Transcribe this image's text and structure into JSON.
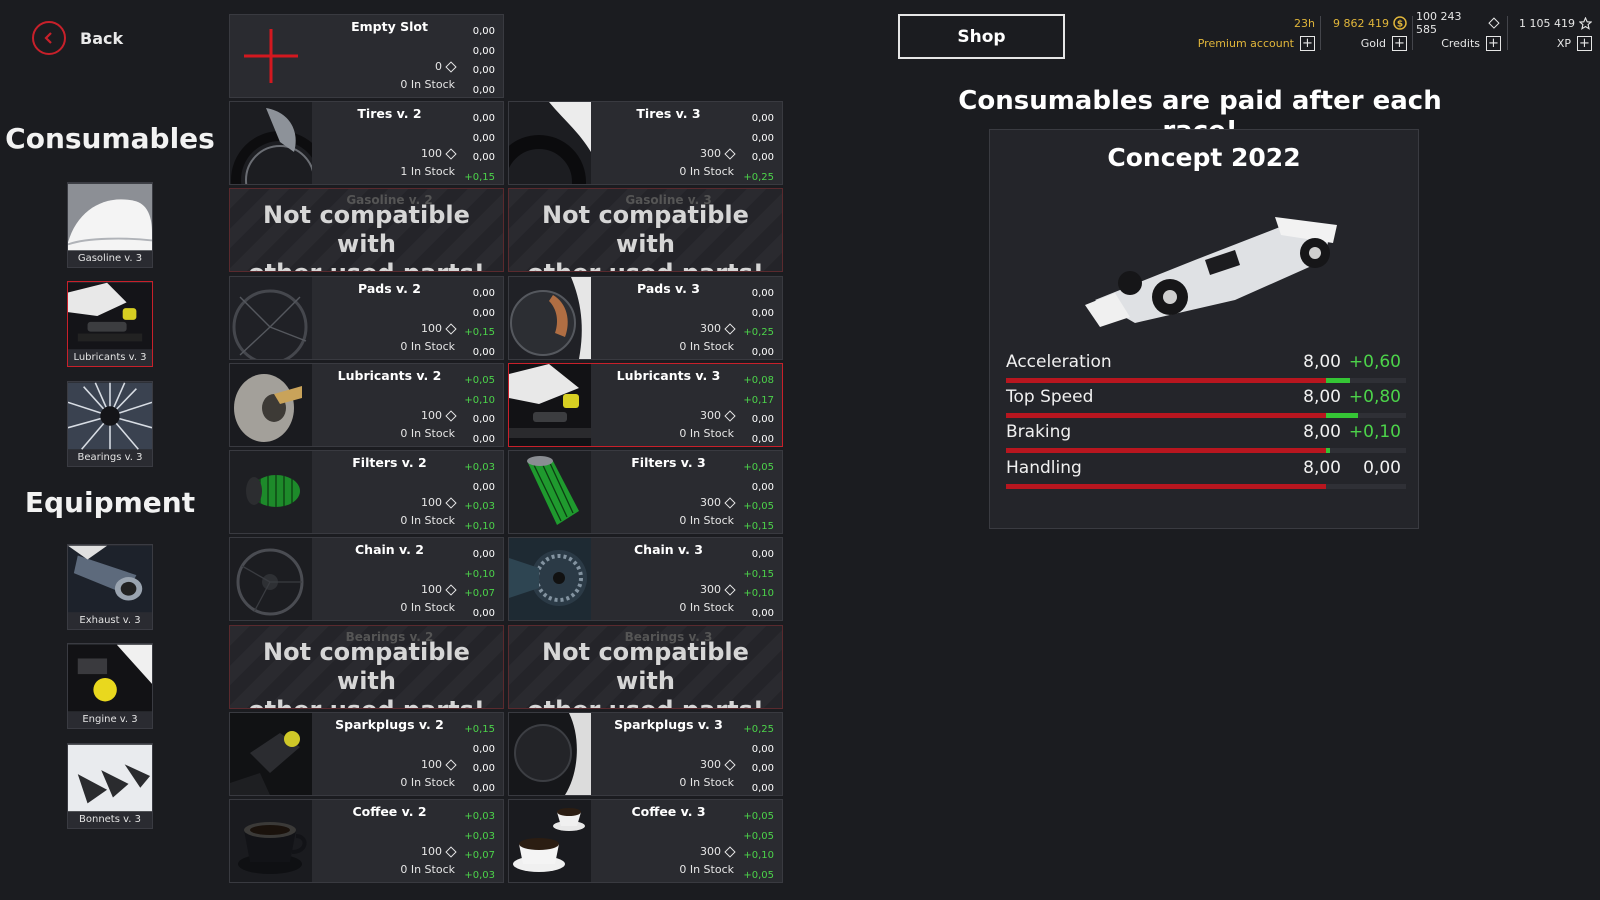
{
  "nav": {
    "back_label": "Back"
  },
  "sections": {
    "consumables_title": "Consumables",
    "equipment_title": "Equipment"
  },
  "consumables": [
    {
      "label": "Gasoline v. 3",
      "icon": "gas-tank-icon"
    },
    {
      "label": "Lubricants v. 3",
      "icon": "lubricant-icon",
      "active": true
    },
    {
      "label": "Bearings v. 3",
      "icon": "bearing-icon"
    }
  ],
  "equipment": [
    {
      "label": "Exhaust v. 3",
      "icon": "exhaust-icon"
    },
    {
      "label": "Engine v. 3",
      "icon": "engine-icon"
    },
    {
      "label": "Bonnets v. 3",
      "icon": "bonnet-icon"
    }
  ],
  "parts": {
    "empty": {
      "name": "Empty Slot",
      "price": "0",
      "stock": "0 In Stock",
      "stats": [
        "0,00",
        "0,00",
        "0,00",
        "0,00"
      ]
    },
    "incompatible_message_line1": "Not compatible with",
    "incompatible_message_line2": "other used parts!",
    "gasoline_v2": {
      "name": "Gasoline v. 2"
    },
    "gasoline_v3": {
      "name": "Gasoline v. 3"
    },
    "bearings_v2": {
      "name": "Bearings v. 2"
    },
    "bearings_v3": {
      "name": "Bearings v. 3"
    },
    "tires_v2": {
      "name": "Tires v. 2",
      "price": "100",
      "stock": "1 In Stock",
      "stats": [
        "0,00",
        "0,00",
        "0,00",
        "+0,15"
      ]
    },
    "tires_v3": {
      "name": "Tires v. 3",
      "price": "300",
      "stock": "0 In Stock",
      "stats": [
        "0,00",
        "0,00",
        "0,00",
        "+0,25"
      ]
    },
    "pads_v2": {
      "name": "Pads v. 2",
      "price": "100",
      "stock": "0 In Stock",
      "stats": [
        "0,00",
        "0,00",
        "+0,15",
        "0,00"
      ]
    },
    "pads_v3": {
      "name": "Pads v. 3",
      "price": "300",
      "stock": "0 In Stock",
      "stats": [
        "0,00",
        "0,00",
        "+0,25",
        "0,00"
      ]
    },
    "lub_v2": {
      "name": "Lubricants v. 2",
      "price": "100",
      "stock": "0 In Stock",
      "stats": [
        "+0,05",
        "+0,10",
        "0,00",
        "0,00"
      ]
    },
    "lub_v3": {
      "name": "Lubricants v. 3",
      "price": "300",
      "stock": "0 In Stock",
      "stats": [
        "+0,08",
        "+0,17",
        "0,00",
        "0,00"
      ]
    },
    "filt_v2": {
      "name": "Filters v. 2",
      "price": "100",
      "stock": "0 In Stock",
      "stats": [
        "+0,03",
        "0,00",
        "+0,03",
        "+0,10"
      ]
    },
    "filt_v3": {
      "name": "Filters v. 3",
      "price": "300",
      "stock": "0 In Stock",
      "stats": [
        "+0,05",
        "0,00",
        "+0,05",
        "+0,15"
      ]
    },
    "chain_v2": {
      "name": "Chain v. 2",
      "price": "100",
      "stock": "0 In Stock",
      "stats": [
        "0,00",
        "+0,10",
        "+0,07",
        "0,00"
      ]
    },
    "chain_v3": {
      "name": "Chain v. 3",
      "price": "300",
      "stock": "0 In Stock",
      "stats": [
        "0,00",
        "+0,15",
        "+0,10",
        "0,00"
      ]
    },
    "spark_v2": {
      "name": "Sparkplugs v. 2",
      "price": "100",
      "stock": "0 In Stock",
      "stats": [
        "+0,15",
        "0,00",
        "0,00",
        "0,00"
      ]
    },
    "spark_v3": {
      "name": "Sparkplugs v. 3",
      "price": "300",
      "stock": "0 In Stock",
      "stats": [
        "+0,25",
        "0,00",
        "0,00",
        "0,00"
      ]
    },
    "coffee_v2": {
      "name": "Coffee v. 2",
      "price": "100",
      "stock": "0 In Stock",
      "stats": [
        "+0,03",
        "+0,03",
        "+0,07",
        "+0,03"
      ]
    },
    "coffee_v3": {
      "name": "Coffee v. 3",
      "price": "300",
      "stock": "0 In Stock",
      "stats": [
        "+0,05",
        "+0,05",
        "+0,10",
        "+0,05"
      ]
    }
  },
  "topbar": {
    "shop_label": "Shop",
    "premium": {
      "value": "23h",
      "label": "Premium account"
    },
    "gold": {
      "value": "9 862 419",
      "label": "Gold"
    },
    "credits": {
      "value": "100 243 585",
      "label": "Credits"
    },
    "xp": {
      "value": "1 105 419",
      "label": "XP"
    }
  },
  "info": {
    "banner": "Consumables are paid after each race!",
    "car_name": "Concept 2022",
    "stats": [
      {
        "name": "Acceleration",
        "value": "8,00",
        "bonus": "+0,60",
        "level": 0.8,
        "bonus_level": 0.06
      },
      {
        "name": "Top Speed",
        "value": "8,00",
        "bonus": "+0,80",
        "level": 0.8,
        "bonus_level": 0.08
      },
      {
        "name": "Braking",
        "value": "8,00",
        "bonus": "+0,10",
        "level": 0.8,
        "bonus_level": 0.01
      },
      {
        "name": "Handling",
        "value": "8,00",
        "bonus": "0,00",
        "level": 0.8,
        "bonus_level": 0
      }
    ]
  },
  "colors": {
    "accent_red": "#c8202a",
    "bonus_green": "#4cd34a",
    "gold": "#e0b53a"
  }
}
